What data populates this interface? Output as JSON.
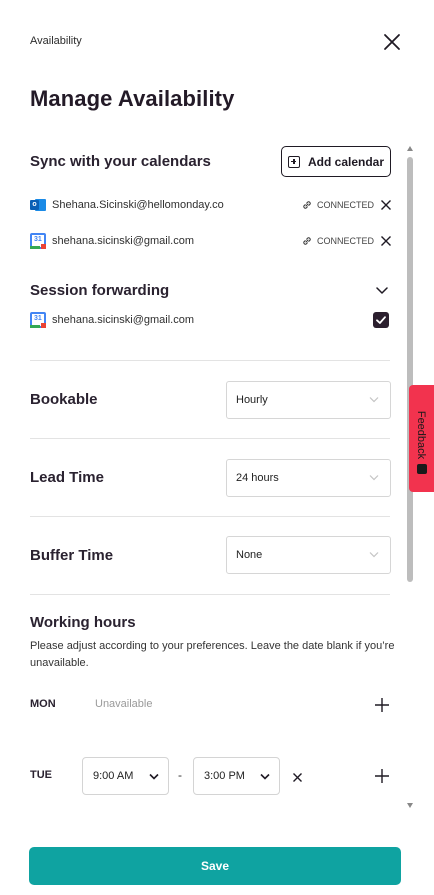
{
  "header": {
    "breadcrumb": "Availability",
    "title": "Manage Availability"
  },
  "sync": {
    "heading": "Sync with your calendars",
    "add_label": "Add calendar",
    "calendars": [
      {
        "provider": "outlook",
        "email": "Shehana.Sicinski@hellomonday.co",
        "status": "CONNECTED"
      },
      {
        "provider": "google",
        "email": "shehana.sicinski@gmail.com",
        "status": "CONNECTED"
      }
    ]
  },
  "forwarding": {
    "heading": "Session forwarding",
    "email": "shehana.sicinski@gmail.com",
    "checked": true
  },
  "bookable": {
    "label": "Bookable",
    "value": "Hourly"
  },
  "lead_time": {
    "label": "Lead Time",
    "value": "24 hours"
  },
  "buffer_time": {
    "label": "Buffer Time",
    "value": "None"
  },
  "working_hours": {
    "heading": "Working hours",
    "description": "Please adjust according to your preferences. Leave the date blank if you’re unavailable.",
    "days": [
      {
        "day": "MON",
        "unavailable_text": "Unavailable"
      },
      {
        "day": "TUE",
        "start": "9:00 AM",
        "dash": "-",
        "end": "3:00 PM"
      }
    ]
  },
  "save_label": "Save",
  "feedback_label": "Feedback",
  "colors": {
    "accent": "#0fa3a1",
    "feedback": "#f2334e",
    "text": "#231a27"
  }
}
